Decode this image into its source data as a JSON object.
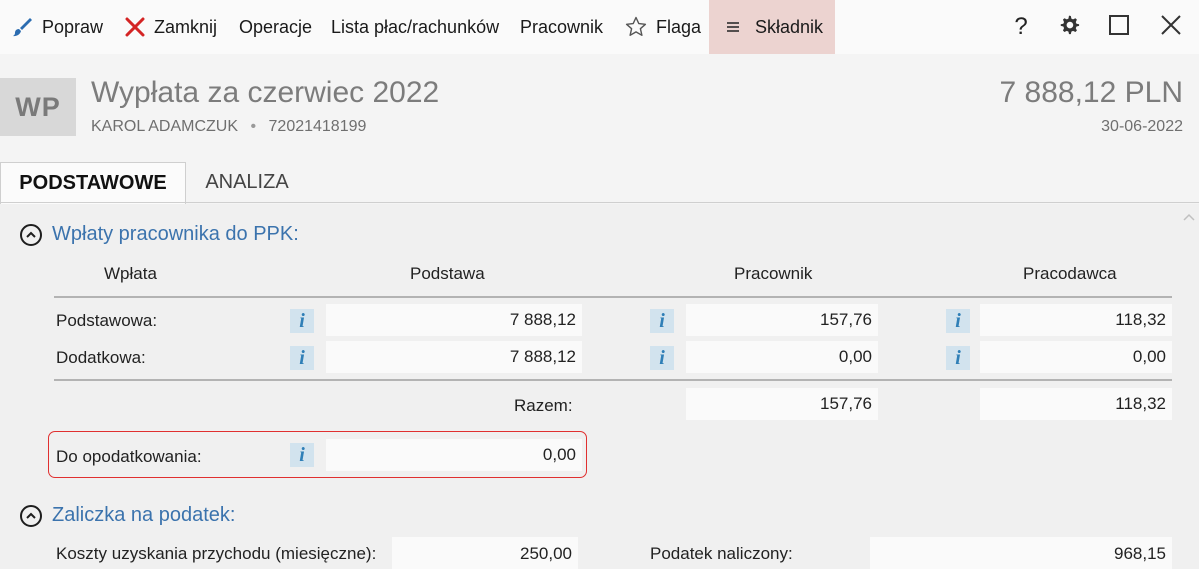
{
  "toolbar": {
    "popraw": "Popraw",
    "zamknij": "Zamknij",
    "operacje": "Operacje",
    "lista": "Lista płac/rachunków",
    "pracownik": "Pracownik",
    "flaga": "Flaga",
    "skladnik": "Składnik",
    "help": "?"
  },
  "header": {
    "avatar": "WP",
    "title": "Wypłata za czerwiec 2022",
    "employee": "KAROL ADAMCZUK",
    "separator": "•",
    "pesel": "72021418199",
    "amount": "7 888,12 PLN",
    "date": "30-06-2022"
  },
  "tabs": {
    "basic": "PODSTAWOWE",
    "analysis": "ANALIZA"
  },
  "ppk": {
    "title": "Wpłaty pracownika do PPK:",
    "columns": {
      "wplata": "Wpłata",
      "podstawa": "Podstawa",
      "pracownik": "Pracownik",
      "pracodawca": "Pracodawca"
    },
    "rows": [
      {
        "label": "Podstawowa:",
        "podstawa": "7 888,12",
        "pracownik": "157,76",
        "pracodawca": "118,32"
      },
      {
        "label": "Dodatkowa:",
        "podstawa": "7 888,12",
        "pracownik": "0,00",
        "pracodawca": "0,00"
      }
    ],
    "total_label": "Razem:",
    "total_pracownik": "157,76",
    "total_pracodawca": "118,32",
    "taxable_label": "Do opodatkowania:",
    "taxable_value": "0,00"
  },
  "tax": {
    "title": "Zaliczka na podatek:",
    "costs_label": "Koszty uzyskania przychodu (miesięczne):",
    "costs_value": "250,00",
    "tax_label": "Podatek naliczony:",
    "tax_value": "968,15"
  },
  "colors": {
    "accent": "#3b73ad",
    "info_icon": "#2f7fb7",
    "highlight": "#e03030",
    "active_toolbar": "#ecd3d0"
  }
}
